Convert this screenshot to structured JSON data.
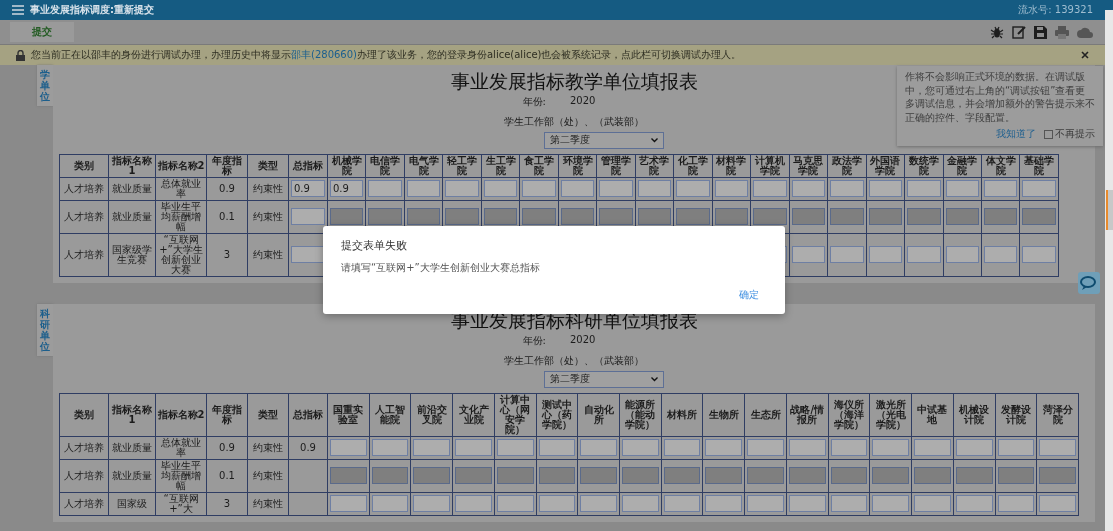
{
  "header": {
    "title": "事业发展指标调度:重新提交",
    "serial": "流水号: 139321"
  },
  "toolbar": {
    "submit": "提交"
  },
  "notice": {
    "before": "您当前正在以邵丰的身份进行调试办理，办理历史中将显示",
    "link": "邵丰(280660)",
    "after": "办理了该业务，您的登录身份alice(alice)也会被系统记录，点此栏可切换调试办理人。"
  },
  "debug_tip": {
    "text": "作将不会影响正式环境的数据。在调试版中，您可通过右上角的“调试按钮”查看更多调试信息，并会增加额外的警告提示来不正确的控件、字段配置。",
    "link": "我知道了",
    "checkbox": {
      "label": "不再提示",
      "checked": false
    }
  },
  "sections": [
    {
      "tab": "学单位",
      "title": "事业发展指标教学单位填报表",
      "year_label": "年份:",
      "year": "2020",
      "dept": "学生工作部（处）、（武装部）",
      "quarter": "第二季度",
      "columns": [
        "类别",
        "指标名称1",
        "指标名称2",
        "年度指标",
        "类型",
        "总指标",
        "机械学院",
        "电信学院",
        "电气学院",
        "轻工学院",
        "生工学院",
        "食工学院",
        "环境学院",
        "管理学院",
        "艺术学院",
        "化工学院",
        "材料学院",
        "计算机学院",
        "马克思学院",
        "政法学院",
        "外国语学院",
        "数统学院",
        "金融学院",
        "体文学院",
        "基础学院"
      ],
      "rows": [
        {
          "category": "人才培养",
          "name1": "就业质量",
          "name2": "总体就业率",
          "annual": "0.9",
          "type": "约束性",
          "total": {
            "kind": "input",
            "value": "0.9",
            "disabled": false
          },
          "inputs_disabled": false,
          "input_values": [
            "0.9"
          ]
        },
        {
          "category": "人才培养",
          "name1": "就业质量",
          "name2": "毕业生平均薪酬增幅",
          "annual": "0.1",
          "type": "约束性",
          "total": {
            "kind": "input",
            "disabled": false
          },
          "inputs_disabled": true
        },
        {
          "category": "人才培养",
          "name1": "国家级学生竞赛",
          "name2": "“互联网+”大学生创新创业大赛",
          "annual": "3",
          "type": "约束性",
          "total": {
            "kind": "input",
            "disabled": false
          },
          "inputs_disabled": false
        }
      ]
    },
    {
      "tab": "科研单位",
      "title": "事业发展指标科研单位填报表",
      "year_label": "年份:",
      "year": "2020",
      "dept": "学生工作部（处）、（武装部）",
      "quarter": "第二季度",
      "columns": [
        "类别",
        "指标名称1",
        "指标名称2",
        "年度指标",
        "类型",
        "总指标",
        "国重实验室",
        "人工智能院",
        "前沿交叉院",
        "文化产业院",
        "计算中心（网安学院）",
        "测试中心（药学院）",
        "自动化所",
        "能源所（能动学院）",
        "材料所",
        "生物所",
        "生态所",
        "战略/情报所",
        "海仪所（海洋学院）",
        "激光所（光电学院）",
        "中试基地",
        "机械设计院",
        "发酵设计院",
        "菏泽分院"
      ],
      "rows": [
        {
          "category": "人才培养",
          "name1": "就业质量",
          "name2": "总体就业率",
          "annual": "0.9",
          "type": "约束性",
          "total": {
            "kind": "text",
            "value": "0.9"
          },
          "inputs_disabled": false
        },
        {
          "category": "人才培养",
          "name1": "就业质量",
          "name2": "毕业生平均薪酬增幅",
          "annual": "0.1",
          "type": "约束性",
          "total": {
            "kind": "text"
          },
          "inputs_disabled": true
        },
        {
          "category": "人才培养",
          "name1": "国家级",
          "name2": "“互联网+”大",
          "annual": "3",
          "type": "约束性",
          "total": {
            "kind": "text"
          },
          "inputs_disabled": false
        }
      ]
    }
  ],
  "dialog": {
    "title": "提交表单失败",
    "message": "请填写“互联网+”大学生创新创业大赛总指标",
    "button": "确定"
  }
}
